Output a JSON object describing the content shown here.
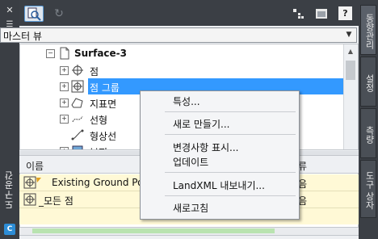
{
  "palette": {
    "vertical_title": "도구공간",
    "close_glyph": "✕",
    "menu_glyph": "☰",
    "settings_glyph": "✱",
    "corner_logo": "C"
  },
  "toolbar": {
    "refresh_glyph": "↻",
    "help_label": "?"
  },
  "view_select": {
    "value": "마스터 뷰",
    "arrow": "▼"
  },
  "tree": {
    "surface": "Surface-3",
    "items": [
      {
        "label": "점",
        "expander": "+"
      },
      {
        "label": "점 그룹",
        "expander": "+"
      },
      {
        "label": "지표면",
        "expander": "+"
      },
      {
        "label": "선형",
        "expander": "+"
      },
      {
        "label": "형상선",
        "expander": ""
      },
      {
        "label": "부지",
        "expander": "+"
      }
    ]
  },
  "list": {
    "columns": {
      "name": "이름",
      "type": "류"
    },
    "rows": [
      {
        "name": "Existing Ground Poi",
        "type": "음"
      },
      {
        "name": "_모든 점",
        "type": "음"
      }
    ]
  },
  "right_tabs": {
    "tab1": "동향관리",
    "tab2": "설정",
    "tab3": "측량",
    "tab4": "도구 상자"
  },
  "context_menu": {
    "properties": "특성...",
    "new": "새로 만들기...",
    "show_changes": "변경사항 표시...",
    "update": "업데이트",
    "landxml_export": "LandXML 내보내기...",
    "refresh": "새로고침"
  }
}
